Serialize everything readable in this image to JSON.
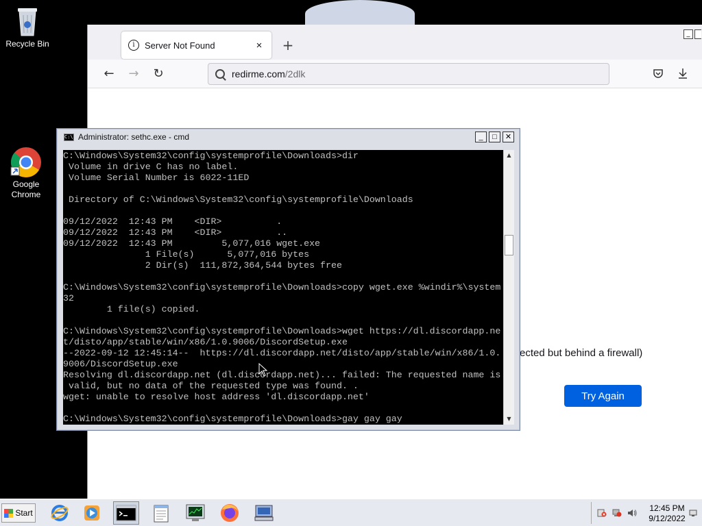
{
  "desktop": {
    "icons": [
      {
        "label": "Recycle Bin",
        "icon": "recycle-bin-icon"
      },
      {
        "label": "Google Chrome",
        "label_line1": "Google",
        "label_line2": "Chrome",
        "icon": "chrome-icon"
      }
    ]
  },
  "browser": {
    "tab_title": "Server Not Found",
    "tab_close": "×",
    "new_tab": "+",
    "url_host": "redirme.com",
    "url_path": "/2dlk",
    "page_partial_text": "ected but behind a firewall)",
    "try_again_label": "Try Again"
  },
  "cmd": {
    "title": "Administrator: sethc.exe - cmd",
    "icon_text": "C:\\",
    "lines": [
      "C:\\Windows\\System32\\config\\systemprofile\\Downloads>dir",
      " Volume in drive C has no label.",
      " Volume Serial Number is 6022-11ED",
      "",
      " Directory of C:\\Windows\\System32\\config\\systemprofile\\Downloads",
      "",
      "09/12/2022  12:43 PM    <DIR>          .",
      "09/12/2022  12:43 PM    <DIR>          ..",
      "09/12/2022  12:43 PM         5,077,016 wget.exe",
      "               1 File(s)      5,077,016 bytes",
      "               2 Dir(s)  111,872,364,544 bytes free",
      "",
      "C:\\Windows\\System32\\config\\systemprofile\\Downloads>copy wget.exe %windir%\\system",
      "32",
      "        1 file(s) copied.",
      "",
      "C:\\Windows\\System32\\config\\systemprofile\\Downloads>wget https://dl.discordapp.ne",
      "t/disto/app/stable/win/x86/1.0.9006/DiscordSetup.exe",
      "--2022-09-12 12:45:14--  https://dl.discordapp.net/disto/app/stable/win/x86/1.0.",
      "9006/DiscordSetup.exe",
      "Resolving dl.discordapp.net (dl.discordapp.net)... failed: The requested name is",
      " valid, but no data of the requested type was found. .",
      "wget: unable to resolve host address 'dl.discordapp.net'",
      "",
      "C:\\Windows\\System32\\config\\systemprofile\\Downloads>gay gay gay"
    ]
  },
  "taskbar": {
    "start_label": "Start",
    "apps": [
      "internet-explorer-icon",
      "media-player-icon",
      "cmd-icon",
      "notepad-icon",
      "task-manager-icon",
      "firefox-icon",
      "network-icon"
    ],
    "clock_time": "12:45 PM",
    "clock_date": "9/12/2022"
  }
}
